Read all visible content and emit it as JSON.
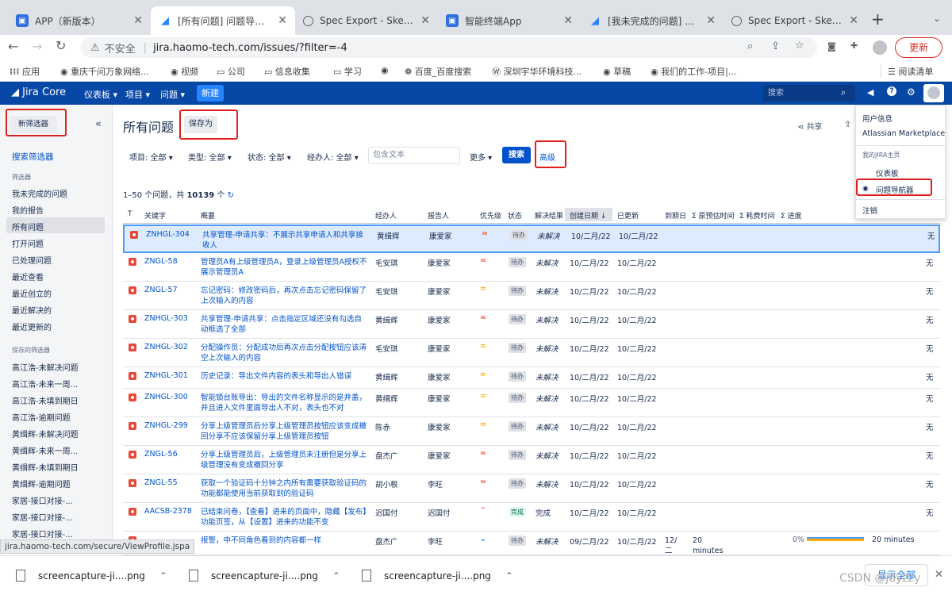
{
  "browser": {
    "tabs": [
      {
        "title": "APP（新版本）",
        "icon": "app-icon",
        "color": "#2f6fde"
      },
      {
        "title": "[所有问题] 问题导航器 -",
        "icon": "jira-icon",
        "color": "#2684ff"
      },
      {
        "title": "Spec Export - Sketch",
        "icon": "globe-icon",
        "color": "#5f6368"
      },
      {
        "title": "智能终端App",
        "icon": "app-icon",
        "color": "#2f6fde"
      },
      {
        "title": "[我未完成的问题] 问题!",
        "icon": "jira-icon",
        "color": "#2684ff"
      },
      {
        "title": "Spec Export - Sketch",
        "icon": "globe-icon",
        "color": "#5f6368"
      }
    ],
    "new_tab": "+",
    "insecure_label": "不安全",
    "url": "jira.haomo-tech.com/issues/?filter=-4",
    "update_label": "更新",
    "bookmarks": [
      "应用",
      "重庆千问万象网络...",
      "视频",
      "公司",
      "信息收集",
      "学习",
      "",
      "百度_百度搜索",
      "深圳宇华环境科技...",
      "草稿",
      "我们的工作-项目|..."
    ],
    "reading_list": "阅读清单",
    "status_url": "jira.haomo-tech.com/secure/ViewProfile.jspa"
  },
  "jira": {
    "logo": "Jira Core",
    "nav": [
      "仪表板 ▾",
      "项目 ▾",
      "问题 ▾"
    ],
    "create": "新建",
    "search_placeholder": "搜索",
    "sidebar": {
      "new_filter": "新筛选器",
      "collapse": "«",
      "search_filters": "搜索筛选器",
      "filters_heading": "筛选器",
      "filters": [
        "我未完成的问题",
        "我的报告",
        "所有问题",
        "打开问题",
        "已处理问题",
        "最近查看",
        "最近创立的",
        "最近解决的",
        "最近更新的"
      ],
      "saved_heading": "保存的筛选器",
      "saved": [
        "高江浩-未解决问题",
        "高江浩-未来一周...",
        "高江浩-未填到期日",
        "高江浩-逾期问题",
        "黄缉辉-未解决问题",
        "黄缉辉-未来一周...",
        "黄缉辉-未填到期日",
        "黄缉辉-逾期问题",
        "家居-接口对接-...",
        "家居-接口对接-...",
        "家居-接口对接-..."
      ]
    },
    "title": "所有问题",
    "save_as": "保存为",
    "share": "共享",
    "filters": {
      "project": "项目: 全部 ▾",
      "type": "类型: 全部 ▾",
      "status": "状态: 全部 ▾",
      "assignee": "经办人: 全部 ▾",
      "text_placeholder": "包含文本",
      "more": "更多 ▾",
      "search": "搜索",
      "advanced": "高级"
    },
    "count_prefix": "1–50 个问题，共 ",
    "count_total": "10139",
    "count_suffix": " 个",
    "columns": [
      "T",
      "关键字",
      "概要",
      "经办人",
      "报告人",
      "优先级",
      "状态",
      "解决结果",
      "创建日期 ↓",
      "已更新",
      "到期日",
      "Σ 原预估时间",
      "Σ 耗费时间",
      "Σ 进度"
    ],
    "rows": [
      {
        "key": "ZNHGL-304",
        "summary": "共享管理-申请共享：不展示共享申请人和共享接收人",
        "assignee": "黄缉辉",
        "reporter": "康爱家",
        "priority": "high",
        "status": "待办",
        "resolution": "未解决",
        "created": "10/二月/22",
        "updated": "10/二月/22",
        "progress": "无"
      },
      {
        "key": "ZNGL-58",
        "summary": "管理员A有上级管理员A，登录上级管理员A授权不展示管理员A",
        "assignee": "毛安琪",
        "reporter": "康爱家",
        "priority": "high",
        "status": "待办",
        "resolution": "未解决",
        "created": "10/二月/22",
        "updated": "10/二月/22",
        "progress": "无"
      },
      {
        "key": "ZNGL-57",
        "summary": "忘记密码：修改密码后，再次点击忘记密码保留了上次输入的内容",
        "assignee": "毛安琪",
        "reporter": "康爱家",
        "priority": "medium",
        "status": "待办",
        "resolution": "未解决",
        "created": "10/二月/22",
        "updated": "10/二月/22",
        "progress": "无"
      },
      {
        "key": "ZNHGL-303",
        "summary": "共享管理-申请共享：点击指定区域还没有勾选自动框选了全部",
        "assignee": "黄缉辉",
        "reporter": "康爱家",
        "priority": "high",
        "status": "待办",
        "resolution": "未解决",
        "created": "10/二月/22",
        "updated": "10/二月/22",
        "progress": "无"
      },
      {
        "key": "ZNHGL-302",
        "summary": "分配操作员：分配成功后再次点击分配按钮应该清空上次输入的内容",
        "assignee": "毛安琪",
        "reporter": "康爱家",
        "priority": "medium",
        "status": "待办",
        "resolution": "未解决",
        "created": "10/二月/22",
        "updated": "10/二月/22",
        "progress": "无"
      },
      {
        "key": "ZNHGL-301",
        "summary": "历史记录：导出文件内容的表头和导出人错误",
        "assignee": "黄缉辉",
        "reporter": "康爱家",
        "priority": "medium",
        "status": "待办",
        "resolution": "未解决",
        "created": "10/二月/22",
        "updated": "10/二月/22",
        "progress": "无"
      },
      {
        "key": "ZNHGL-300",
        "summary": "智能锁台账导出：导出的文件名称显示的是井盖，并且进入文件里面导出人不对，表头也不对",
        "assignee": "黄缉辉",
        "reporter": "康爱家",
        "priority": "medium",
        "status": "待办",
        "resolution": "未解决",
        "created": "10/二月/22",
        "updated": "10/二月/22",
        "progress": "无"
      },
      {
        "key": "ZNHGL-299",
        "summary": "分享上级管理员后分享上级管理员按钮应该变成撤回分享不应该保留分享上级管理员按钮",
        "assignee": "陈赤",
        "reporter": "康爱家",
        "priority": "medium",
        "status": "待办",
        "resolution": "未解决",
        "created": "10/二月/22",
        "updated": "10/二月/22",
        "progress": "无"
      },
      {
        "key": "ZNGL-56",
        "summary": "分享上级管理员后，上级管理员未注册但是分享上级管理没有变成撤回分享",
        "assignee": "盘杰广",
        "reporter": "康爱家",
        "priority": "high",
        "status": "待办",
        "resolution": "未解决",
        "created": "10/二月/22",
        "updated": "10/二月/22",
        "progress": "无"
      },
      {
        "key": "ZNGL-55",
        "summary": "获取一个验证码十分钟之内所有需要获取验证码的功能都能使用当前获取到的验证码",
        "assignee": "胡小根",
        "reporter": "李旺",
        "priority": "high",
        "status": "待办",
        "resolution": "未解决",
        "created": "10/二月/22",
        "updated": "10/二月/22",
        "progress": "无"
      },
      {
        "key": "AACSB-2378",
        "summary": "已结束问卷，【查看】进来的页面中，隐藏【发布】功能页签，从【设置】进来的功能不变",
        "assignee": "迟国付",
        "reporter": "迟国付",
        "priority": "low",
        "status": "完成",
        "resolution": "完成",
        "created": "10/二月/22",
        "updated": "10/二月/22",
        "progress": "无"
      },
      {
        "key": "",
        "summary": "报警，中不同角色看到的内容都一样",
        "assignee": "盘杰广",
        "reporter": "李旺",
        "priority": "lowest",
        "status": "待办",
        "resolution": "未解决",
        "created": "09/二月/22",
        "updated": "10/二月/22",
        "due": "12/二月/22",
        "estimate": "20 minutes",
        "percent": "0%",
        "progress": "20 minutes"
      }
    ],
    "user_menu": {
      "profile": "用户信息",
      "marketplace": "Atlassian Marketplace",
      "home_heading": "我的JIRA主页",
      "dashboard": "仪表板",
      "issue_nav": "问题导航器",
      "logout": "注销"
    }
  },
  "downloads": {
    "files": [
      "screencapture-ji....png",
      "screencapture-ji....png",
      "screencapture-ji....png"
    ],
    "show_all": "显示全部",
    "watermark": "CSDN @jdyzzy"
  }
}
